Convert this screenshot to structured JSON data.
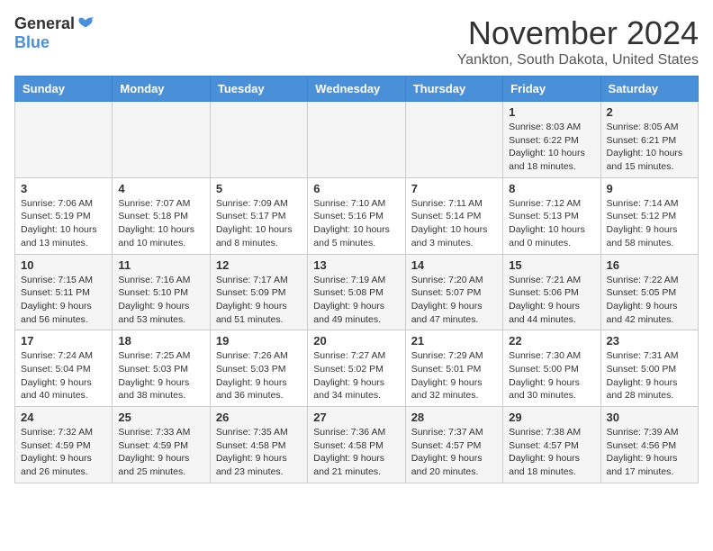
{
  "header": {
    "logo_general": "General",
    "logo_blue": "Blue",
    "month_title": "November 2024",
    "subtitle": "Yankton, South Dakota, United States"
  },
  "weekdays": [
    "Sunday",
    "Monday",
    "Tuesday",
    "Wednesday",
    "Thursday",
    "Friday",
    "Saturday"
  ],
  "weeks": [
    [
      {
        "day": "",
        "info": ""
      },
      {
        "day": "",
        "info": ""
      },
      {
        "day": "",
        "info": ""
      },
      {
        "day": "",
        "info": ""
      },
      {
        "day": "",
        "info": ""
      },
      {
        "day": "1",
        "info": "Sunrise: 8:03 AM\nSunset: 6:22 PM\nDaylight: 10 hours and 18 minutes."
      },
      {
        "day": "2",
        "info": "Sunrise: 8:05 AM\nSunset: 6:21 PM\nDaylight: 10 hours and 15 minutes."
      }
    ],
    [
      {
        "day": "3",
        "info": "Sunrise: 7:06 AM\nSunset: 5:19 PM\nDaylight: 10 hours and 13 minutes."
      },
      {
        "day": "4",
        "info": "Sunrise: 7:07 AM\nSunset: 5:18 PM\nDaylight: 10 hours and 10 minutes."
      },
      {
        "day": "5",
        "info": "Sunrise: 7:09 AM\nSunset: 5:17 PM\nDaylight: 10 hours and 8 minutes."
      },
      {
        "day": "6",
        "info": "Sunrise: 7:10 AM\nSunset: 5:16 PM\nDaylight: 10 hours and 5 minutes."
      },
      {
        "day": "7",
        "info": "Sunrise: 7:11 AM\nSunset: 5:14 PM\nDaylight: 10 hours and 3 minutes."
      },
      {
        "day": "8",
        "info": "Sunrise: 7:12 AM\nSunset: 5:13 PM\nDaylight: 10 hours and 0 minutes."
      },
      {
        "day": "9",
        "info": "Sunrise: 7:14 AM\nSunset: 5:12 PM\nDaylight: 9 hours and 58 minutes."
      }
    ],
    [
      {
        "day": "10",
        "info": "Sunrise: 7:15 AM\nSunset: 5:11 PM\nDaylight: 9 hours and 56 minutes."
      },
      {
        "day": "11",
        "info": "Sunrise: 7:16 AM\nSunset: 5:10 PM\nDaylight: 9 hours and 53 minutes."
      },
      {
        "day": "12",
        "info": "Sunrise: 7:17 AM\nSunset: 5:09 PM\nDaylight: 9 hours and 51 minutes."
      },
      {
        "day": "13",
        "info": "Sunrise: 7:19 AM\nSunset: 5:08 PM\nDaylight: 9 hours and 49 minutes."
      },
      {
        "day": "14",
        "info": "Sunrise: 7:20 AM\nSunset: 5:07 PM\nDaylight: 9 hours and 47 minutes."
      },
      {
        "day": "15",
        "info": "Sunrise: 7:21 AM\nSunset: 5:06 PM\nDaylight: 9 hours and 44 minutes."
      },
      {
        "day": "16",
        "info": "Sunrise: 7:22 AM\nSunset: 5:05 PM\nDaylight: 9 hours and 42 minutes."
      }
    ],
    [
      {
        "day": "17",
        "info": "Sunrise: 7:24 AM\nSunset: 5:04 PM\nDaylight: 9 hours and 40 minutes."
      },
      {
        "day": "18",
        "info": "Sunrise: 7:25 AM\nSunset: 5:03 PM\nDaylight: 9 hours and 38 minutes."
      },
      {
        "day": "19",
        "info": "Sunrise: 7:26 AM\nSunset: 5:03 PM\nDaylight: 9 hours and 36 minutes."
      },
      {
        "day": "20",
        "info": "Sunrise: 7:27 AM\nSunset: 5:02 PM\nDaylight: 9 hours and 34 minutes."
      },
      {
        "day": "21",
        "info": "Sunrise: 7:29 AM\nSunset: 5:01 PM\nDaylight: 9 hours and 32 minutes."
      },
      {
        "day": "22",
        "info": "Sunrise: 7:30 AM\nSunset: 5:00 PM\nDaylight: 9 hours and 30 minutes."
      },
      {
        "day": "23",
        "info": "Sunrise: 7:31 AM\nSunset: 5:00 PM\nDaylight: 9 hours and 28 minutes."
      }
    ],
    [
      {
        "day": "24",
        "info": "Sunrise: 7:32 AM\nSunset: 4:59 PM\nDaylight: 9 hours and 26 minutes."
      },
      {
        "day": "25",
        "info": "Sunrise: 7:33 AM\nSunset: 4:59 PM\nDaylight: 9 hours and 25 minutes."
      },
      {
        "day": "26",
        "info": "Sunrise: 7:35 AM\nSunset: 4:58 PM\nDaylight: 9 hours and 23 minutes."
      },
      {
        "day": "27",
        "info": "Sunrise: 7:36 AM\nSunset: 4:58 PM\nDaylight: 9 hours and 21 minutes."
      },
      {
        "day": "28",
        "info": "Sunrise: 7:37 AM\nSunset: 4:57 PM\nDaylight: 9 hours and 20 minutes."
      },
      {
        "day": "29",
        "info": "Sunrise: 7:38 AM\nSunset: 4:57 PM\nDaylight: 9 hours and 18 minutes."
      },
      {
        "day": "30",
        "info": "Sunrise: 7:39 AM\nSunset: 4:56 PM\nDaylight: 9 hours and 17 minutes."
      }
    ]
  ]
}
